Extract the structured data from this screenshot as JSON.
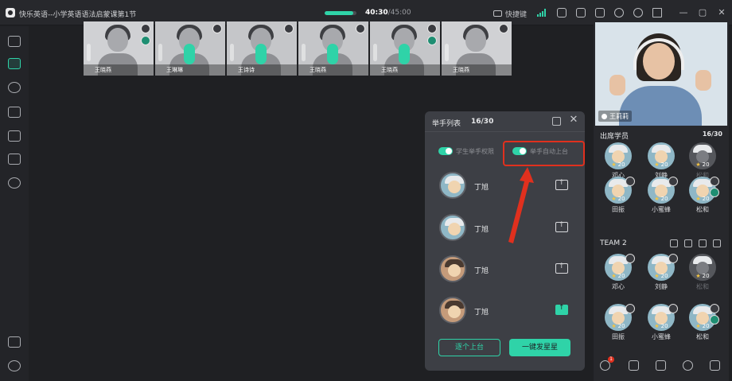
{
  "window": {
    "title": "快乐英语--小学英语语法启蒙课第1节",
    "timer_current": "40:30",
    "timer_total": "/45:00",
    "timer_progress": 0.9,
    "shortcut_label": "快捷键"
  },
  "video_strip": [
    {
      "name": "王晓燕"
    },
    {
      "name": "王琳琳"
    },
    {
      "name": "王诗诗"
    },
    {
      "name": "王晓燕"
    },
    {
      "name": "王晓燕"
    },
    {
      "name": "王晓燕"
    }
  ],
  "raise_panel": {
    "title": "举手列表",
    "count": "16/30",
    "toggle_permission": "学生举手权限",
    "toggle_auto": "举手自动上台",
    "students": [
      {
        "name": "丁旭",
        "on_stage": false
      },
      {
        "name": "丁旭",
        "on_stage": false
      },
      {
        "name": "丁旭",
        "on_stage": false
      },
      {
        "name": "丁旭",
        "on_stage": true
      }
    ],
    "btn_one_by_one": "逐个上台",
    "btn_send_stars": "一键发星星"
  },
  "right_panel": {
    "teacher_name": "王莉莉",
    "attendees_title": "出席学员",
    "attendees_count": "16/30",
    "team1": [
      {
        "name": "邓心",
        "stars": "20",
        "dim": false
      },
      {
        "name": "刘静",
        "stars": "20",
        "dim": false
      },
      {
        "name": "松和",
        "stars": "20",
        "dim": true
      },
      {
        "name": "田振",
        "stars": "20",
        "dim": false
      },
      {
        "name": "小蜜蜂",
        "stars": "20",
        "dim": false
      },
      {
        "name": "松和",
        "stars": "20",
        "dim": false
      }
    ],
    "team2_title": "TEAM 2",
    "team2": [
      {
        "name": "邓心",
        "stars": "20",
        "dim": false
      },
      {
        "name": "刘静",
        "stars": "20",
        "dim": false
      },
      {
        "name": "松和",
        "stars": "20",
        "dim": true
      },
      {
        "name": "田振",
        "stars": "20",
        "dim": false
      },
      {
        "name": "小蜜蜂",
        "stars": "20",
        "dim": false
      },
      {
        "name": "松和",
        "stars": "20",
        "dim": false
      }
    ],
    "hand_badge": "1"
  },
  "colors": {
    "accent": "#2fd3a8",
    "annotation": "#e0301e",
    "background": "#1f2023",
    "panel": "#3d3f45"
  },
  "icons": {
    "left_toolbar": [
      "library-icon",
      "chat-icon",
      "teacher-icon",
      "grid-icon",
      "whiteboard-icon",
      "discount-icon",
      "cloud-icon",
      "toolbox-icon",
      "settings-icon"
    ]
  }
}
